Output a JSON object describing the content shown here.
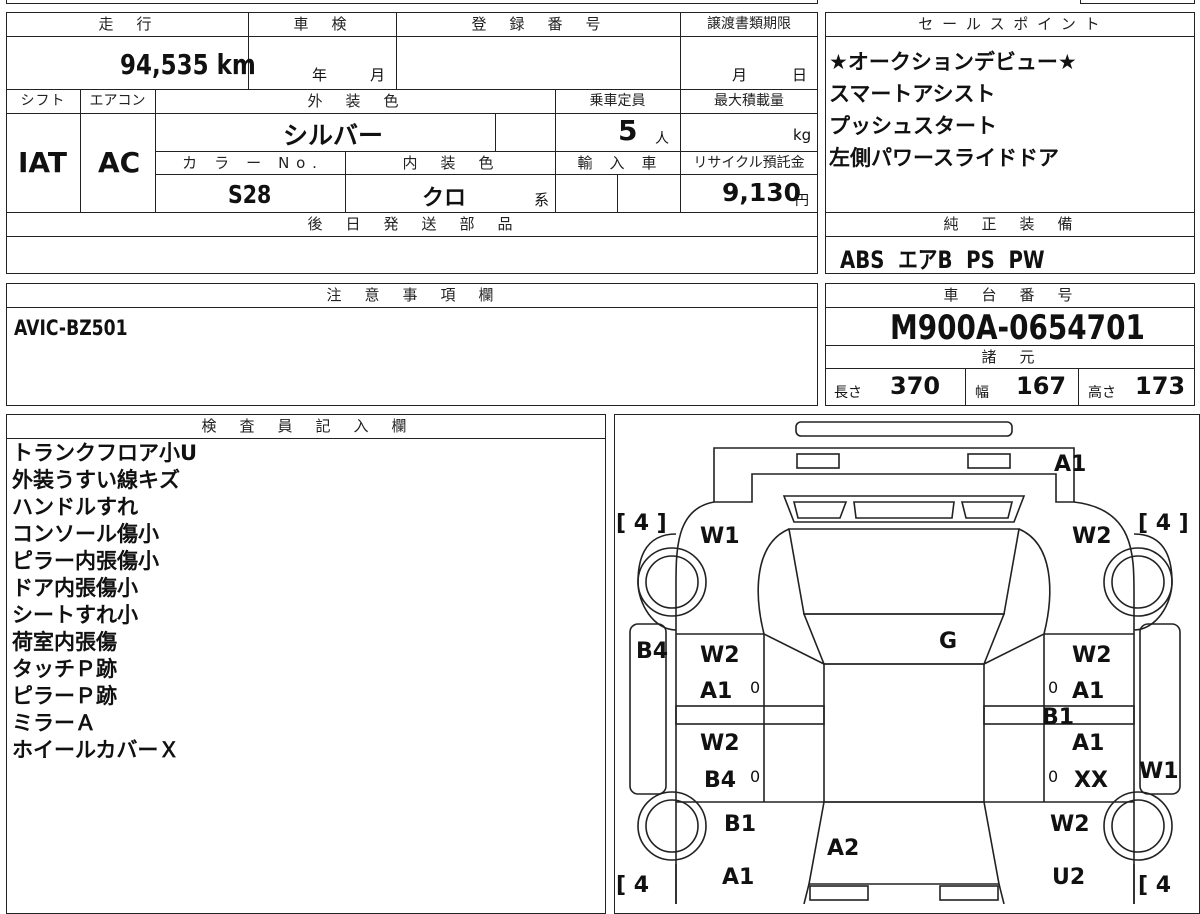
{
  "summary": {
    "h_mileage": "走　行",
    "h_inspection": "車　検",
    "h_reg": "登　録　番　号",
    "h_transfer": "譲渡書類期限",
    "mileage": "94,535 km",
    "insp_year": "年",
    "insp_month": "月",
    "transfer_month": "月",
    "transfer_day": "日",
    "h_shift": "シフト",
    "h_ac": "エアコン",
    "h_exterior": "外　装　色",
    "h_capacity": "乗車定員",
    "h_maxload": "最大積載量",
    "shift": "IAT",
    "ac": "AC",
    "exterior_color": "シルバー",
    "capacity": "5",
    "capacity_unit": "人",
    "maxload_unit": "kg",
    "h_colorno": "カ　ラ　ー　N o .",
    "h_interior": "内　装　色",
    "h_import": "輸　入　車",
    "h_recycle": "リサイクル預託金",
    "color_no": "S28",
    "interior": "クロ",
    "interior_suffix": "系",
    "recycle": "9,130",
    "recycle_unit": "円",
    "h_later_parts": "後　日　発　送　部　品"
  },
  "sales": {
    "header": "セ ー ル ス ポ イ ン ト",
    "points": [
      "★オークションデビュー★",
      "スマートアシスト",
      "プッシュスタート",
      "左側パワースライドドア"
    ]
  },
  "equipment": {
    "header": "純　正　装　備",
    "value": "ABS  エアB  PS  PW"
  },
  "notes": {
    "header": "注　意　事　項　欄",
    "value": "AVIC-BZ501"
  },
  "chassis": {
    "header": "車　台　番　号",
    "value": "M900A-0654701",
    "spec_header": "諸　元",
    "length_label": "長さ",
    "length": "370",
    "width_label": "幅",
    "width": "167",
    "height_label": "高さ",
    "height": "173"
  },
  "inspector": {
    "header": "検　査　員　記　入　欄",
    "items": [
      "トランクフロア小U",
      "外装うすい線キズ",
      "ハンドルすれ",
      "コンソール傷小",
      "ピラー内張傷小",
      "ドア内張傷小",
      "シートすれ小",
      "荷室内張傷",
      "タッチＰ跡",
      "ピラーＰ跡",
      "ミラーＡ",
      "ホイールカバーＸ"
    ]
  },
  "diagram": {
    "tire_fl": "[ 4 ]",
    "tire_fr": "[ 4 ]",
    "tire_rl": "[ 4",
    "tire_rr": "[ 4",
    "marks": {
      "rear": "A1",
      "w1_left": "W1",
      "w2_right": "W2",
      "b4_left": "B4",
      "roof": "G",
      "ld1_w": "W2",
      "ld1_a": "A1",
      "ld2_w": "W2",
      "ld2_b": "B4",
      "rd1_w": "W2",
      "rd1_a": "A1",
      "b1_mid": "B1",
      "rd2_a": "A1",
      "rd2_x": "XX",
      "w1_right": "W1",
      "b1_left": "B1",
      "a2_front": "A2",
      "w2_front": "W2",
      "a1_front": "A1",
      "u2_front": "U2",
      "zero": "0"
    }
  }
}
